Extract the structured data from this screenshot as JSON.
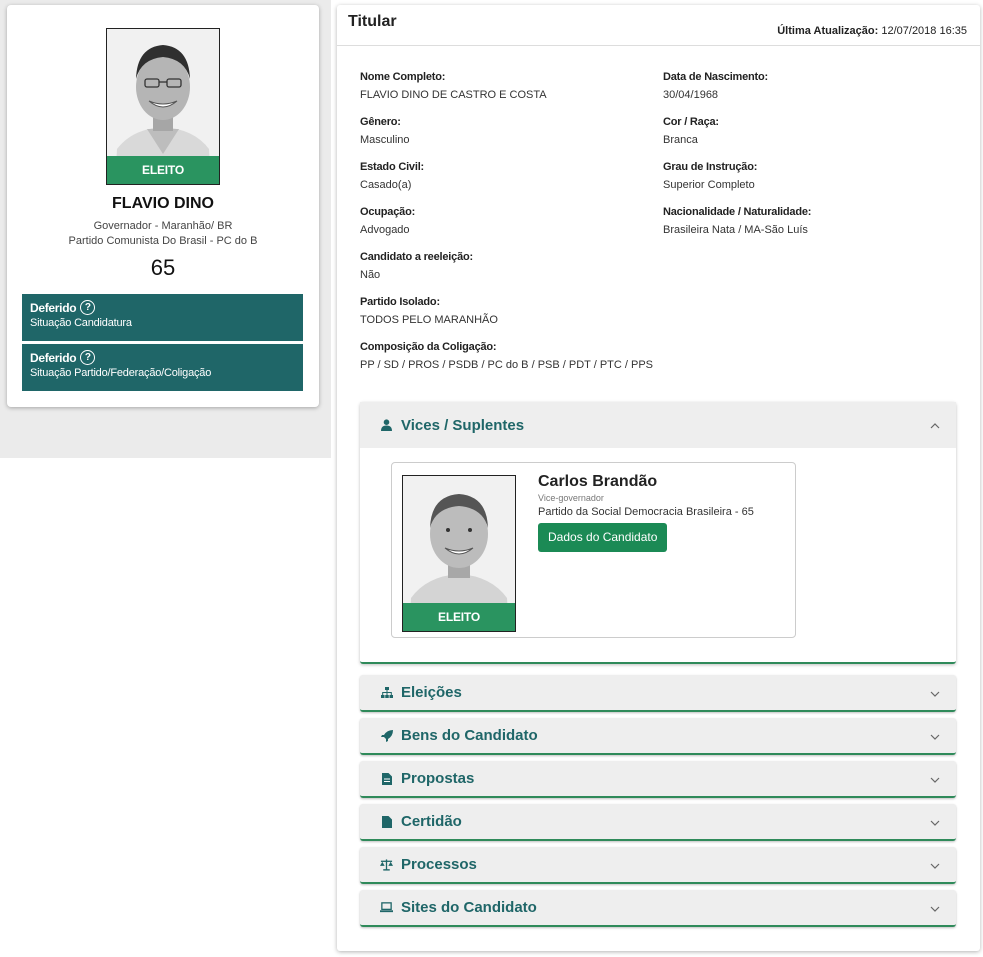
{
  "candidate": {
    "photo_badge": "ELEITO",
    "name": "FLAVIO DINO",
    "office": "Governador - Maranhão/ BR",
    "party": "Partido Comunista Do Brasil - PC do B",
    "number": "65",
    "status": [
      {
        "title": "Deferido",
        "subtitle": "Situação Candidatura"
      },
      {
        "title": "Deferido",
        "subtitle": "Situação Partido/Federação/Coligação"
      }
    ]
  },
  "titular": {
    "title": "Titular",
    "update_label": "Última Atualização:",
    "update_value": "12/07/2018 16:35",
    "fields": {
      "nome_label": "Nome Completo:",
      "nome_value": "FLAVIO DINO DE CASTRO E COSTA",
      "nasc_label": "Data de Nascimento:",
      "nasc_value": "30/04/1968",
      "genero_label": "Gênero:",
      "genero_value": "Masculino",
      "cor_label": "Cor / Raça:",
      "cor_value": "Branca",
      "civil_label": "Estado Civil:",
      "civil_value": "Casado(a)",
      "grau_label": "Grau de Instrução:",
      "grau_value": "Superior Completo",
      "ocup_label": "Ocupação:",
      "ocup_value": "Advogado",
      "nac_label": "Nacionalidade / Naturalidade:",
      "nac_value": "Brasileira Nata / MA-São Luís",
      "reel_label": "Candidato a reeleição:",
      "reel_value": "Não",
      "partido_label": "Partido Isolado:",
      "partido_value": "TODOS PELO MARANHÃO",
      "coligacao_label": "Composição da Coligação:",
      "coligacao_value": "PP / SD / PROS / PSDB / PC do B / PSB / PDT / PTC / PPS"
    }
  },
  "vices": {
    "title": "Vices / Suplentes",
    "name": "Carlos Brandão",
    "role": "Vice-governador",
    "party": "Partido da Social Democracia Brasileira - 65",
    "button": "Dados do Candidato",
    "badge": "ELEITO"
  },
  "sections": {
    "eleicoes": "Eleições",
    "bens": "Bens do Candidato",
    "propostas": "Propostas",
    "certidao": "Certidão",
    "processos": "Processos",
    "sites": "Sites do Candidato"
  },
  "colors": {
    "primary": "#1f6668",
    "badge": "#2a9460",
    "button": "#1b8a55",
    "accent_border": "#2f8a5a"
  }
}
